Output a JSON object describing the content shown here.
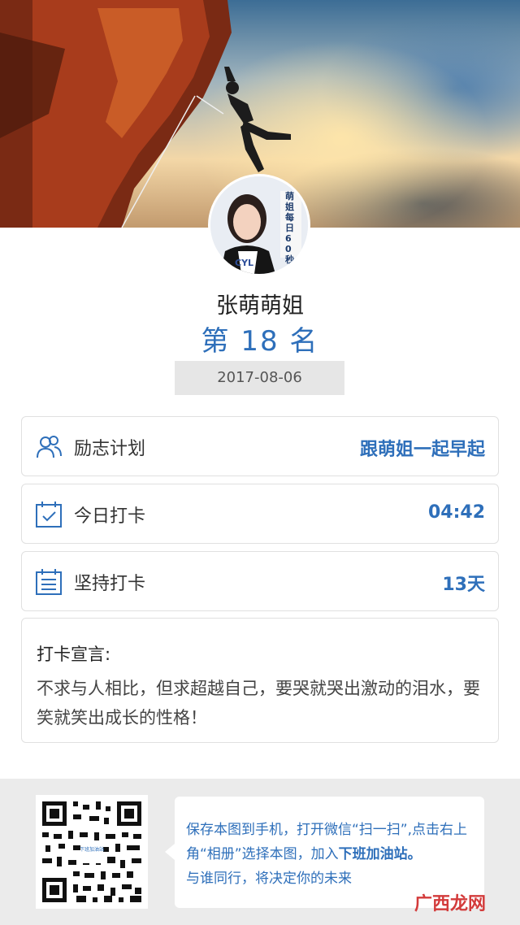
{
  "user": {
    "name": "张萌萌姐",
    "rank_text": "第 18 名",
    "date": "2017-08-06"
  },
  "avatar": {
    "caption": "萌姐每日60秒",
    "badge_text": "CYL"
  },
  "cards": [
    {
      "icon": "people-icon",
      "label": "励志计划",
      "value": "跟萌姐一起早起"
    },
    {
      "icon": "calendar-check-icon",
      "label": "今日打卡",
      "value": "04:42"
    },
    {
      "icon": "calendar-list-icon",
      "label": "坚持打卡",
      "value": "13天"
    }
  ],
  "declaration": {
    "title": "打卡宣言:",
    "body": "不求与人相比，但求超越自己，要哭就哭出激动的泪水，要笑就笑出成长的性格！"
  },
  "footer": {
    "qr_caption": "下班加油站",
    "text_part1": "保存本图到手机，打开微信“扫一扫”,点击右上角“相册”选择本图，加入",
    "highlight": "下班加油站。",
    "text_part2": "与谁同行，将决定你的未来"
  },
  "watermark": "广西龙网",
  "colors": {
    "accent": "#2e6fba",
    "card_border": "#e0e0e0",
    "footer_bg": "#ebebeb"
  }
}
